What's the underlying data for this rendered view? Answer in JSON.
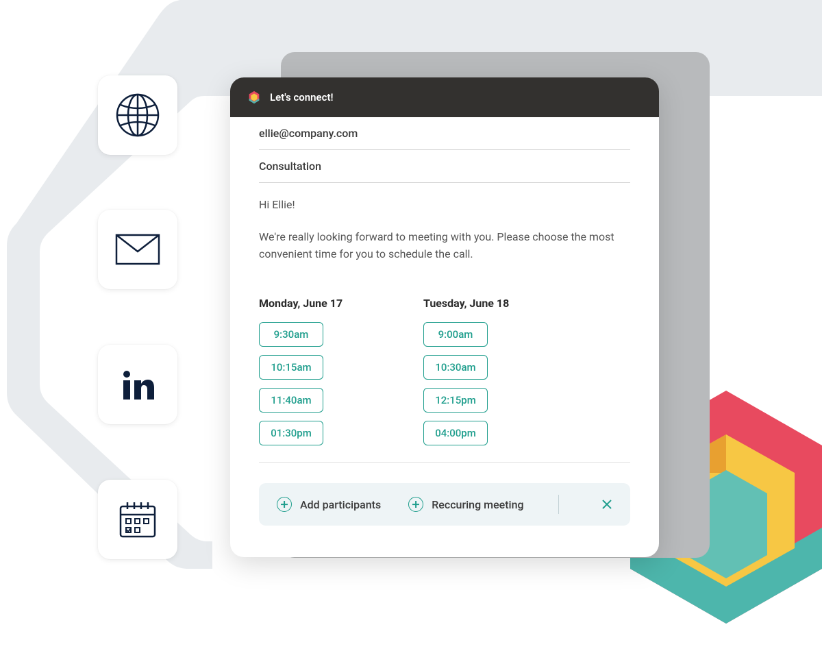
{
  "modal": {
    "title": "Let's connect!",
    "email": "ellie@company.com",
    "subject": "Consultation",
    "greeting": "Hi Ellie!",
    "body": "We're really looking forward to meeting with you. Please choose the most convenient time for you to schedule the call.",
    "days": [
      {
        "label": "Monday, June 17",
        "slots": [
          "9:30am",
          "10:15am",
          "11:40am",
          "01:30pm"
        ]
      },
      {
        "label": "Tuesday, June 18",
        "slots": [
          "9:00am",
          "10:30am",
          "12:15pm",
          "04:00pm"
        ]
      }
    ],
    "footer": {
      "add_participants": "Add participants",
      "recurring": "Reccuring meeting"
    }
  },
  "icons": {
    "globe": "globe-icon",
    "mail": "mail-icon",
    "linkedin": "linkedin-icon",
    "calendar": "calendar-icon"
  },
  "colors": {
    "teal": "#1f9e8d",
    "red": "#e84a5f",
    "yellow": "#f7c744",
    "soft_teal": "#62c0b4",
    "navy": "#0e1f3b"
  }
}
